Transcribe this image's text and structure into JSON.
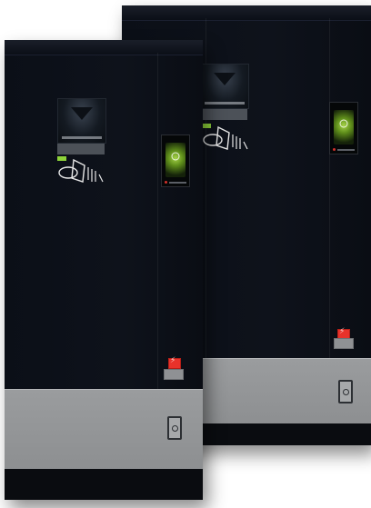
{
  "scene": {
    "description_items": [
      "front-cabinet",
      "rear-cabinet"
    ],
    "colors": {
      "cabinet_body": "#0e121b",
      "lower_panel": "#8d8f91",
      "screen_glow": "#a6d44a",
      "warning_sticker": "#e8322a"
    }
  },
  "icons": [
    "lightning-icon",
    "door-handle-icon",
    "power-icon"
  ]
}
